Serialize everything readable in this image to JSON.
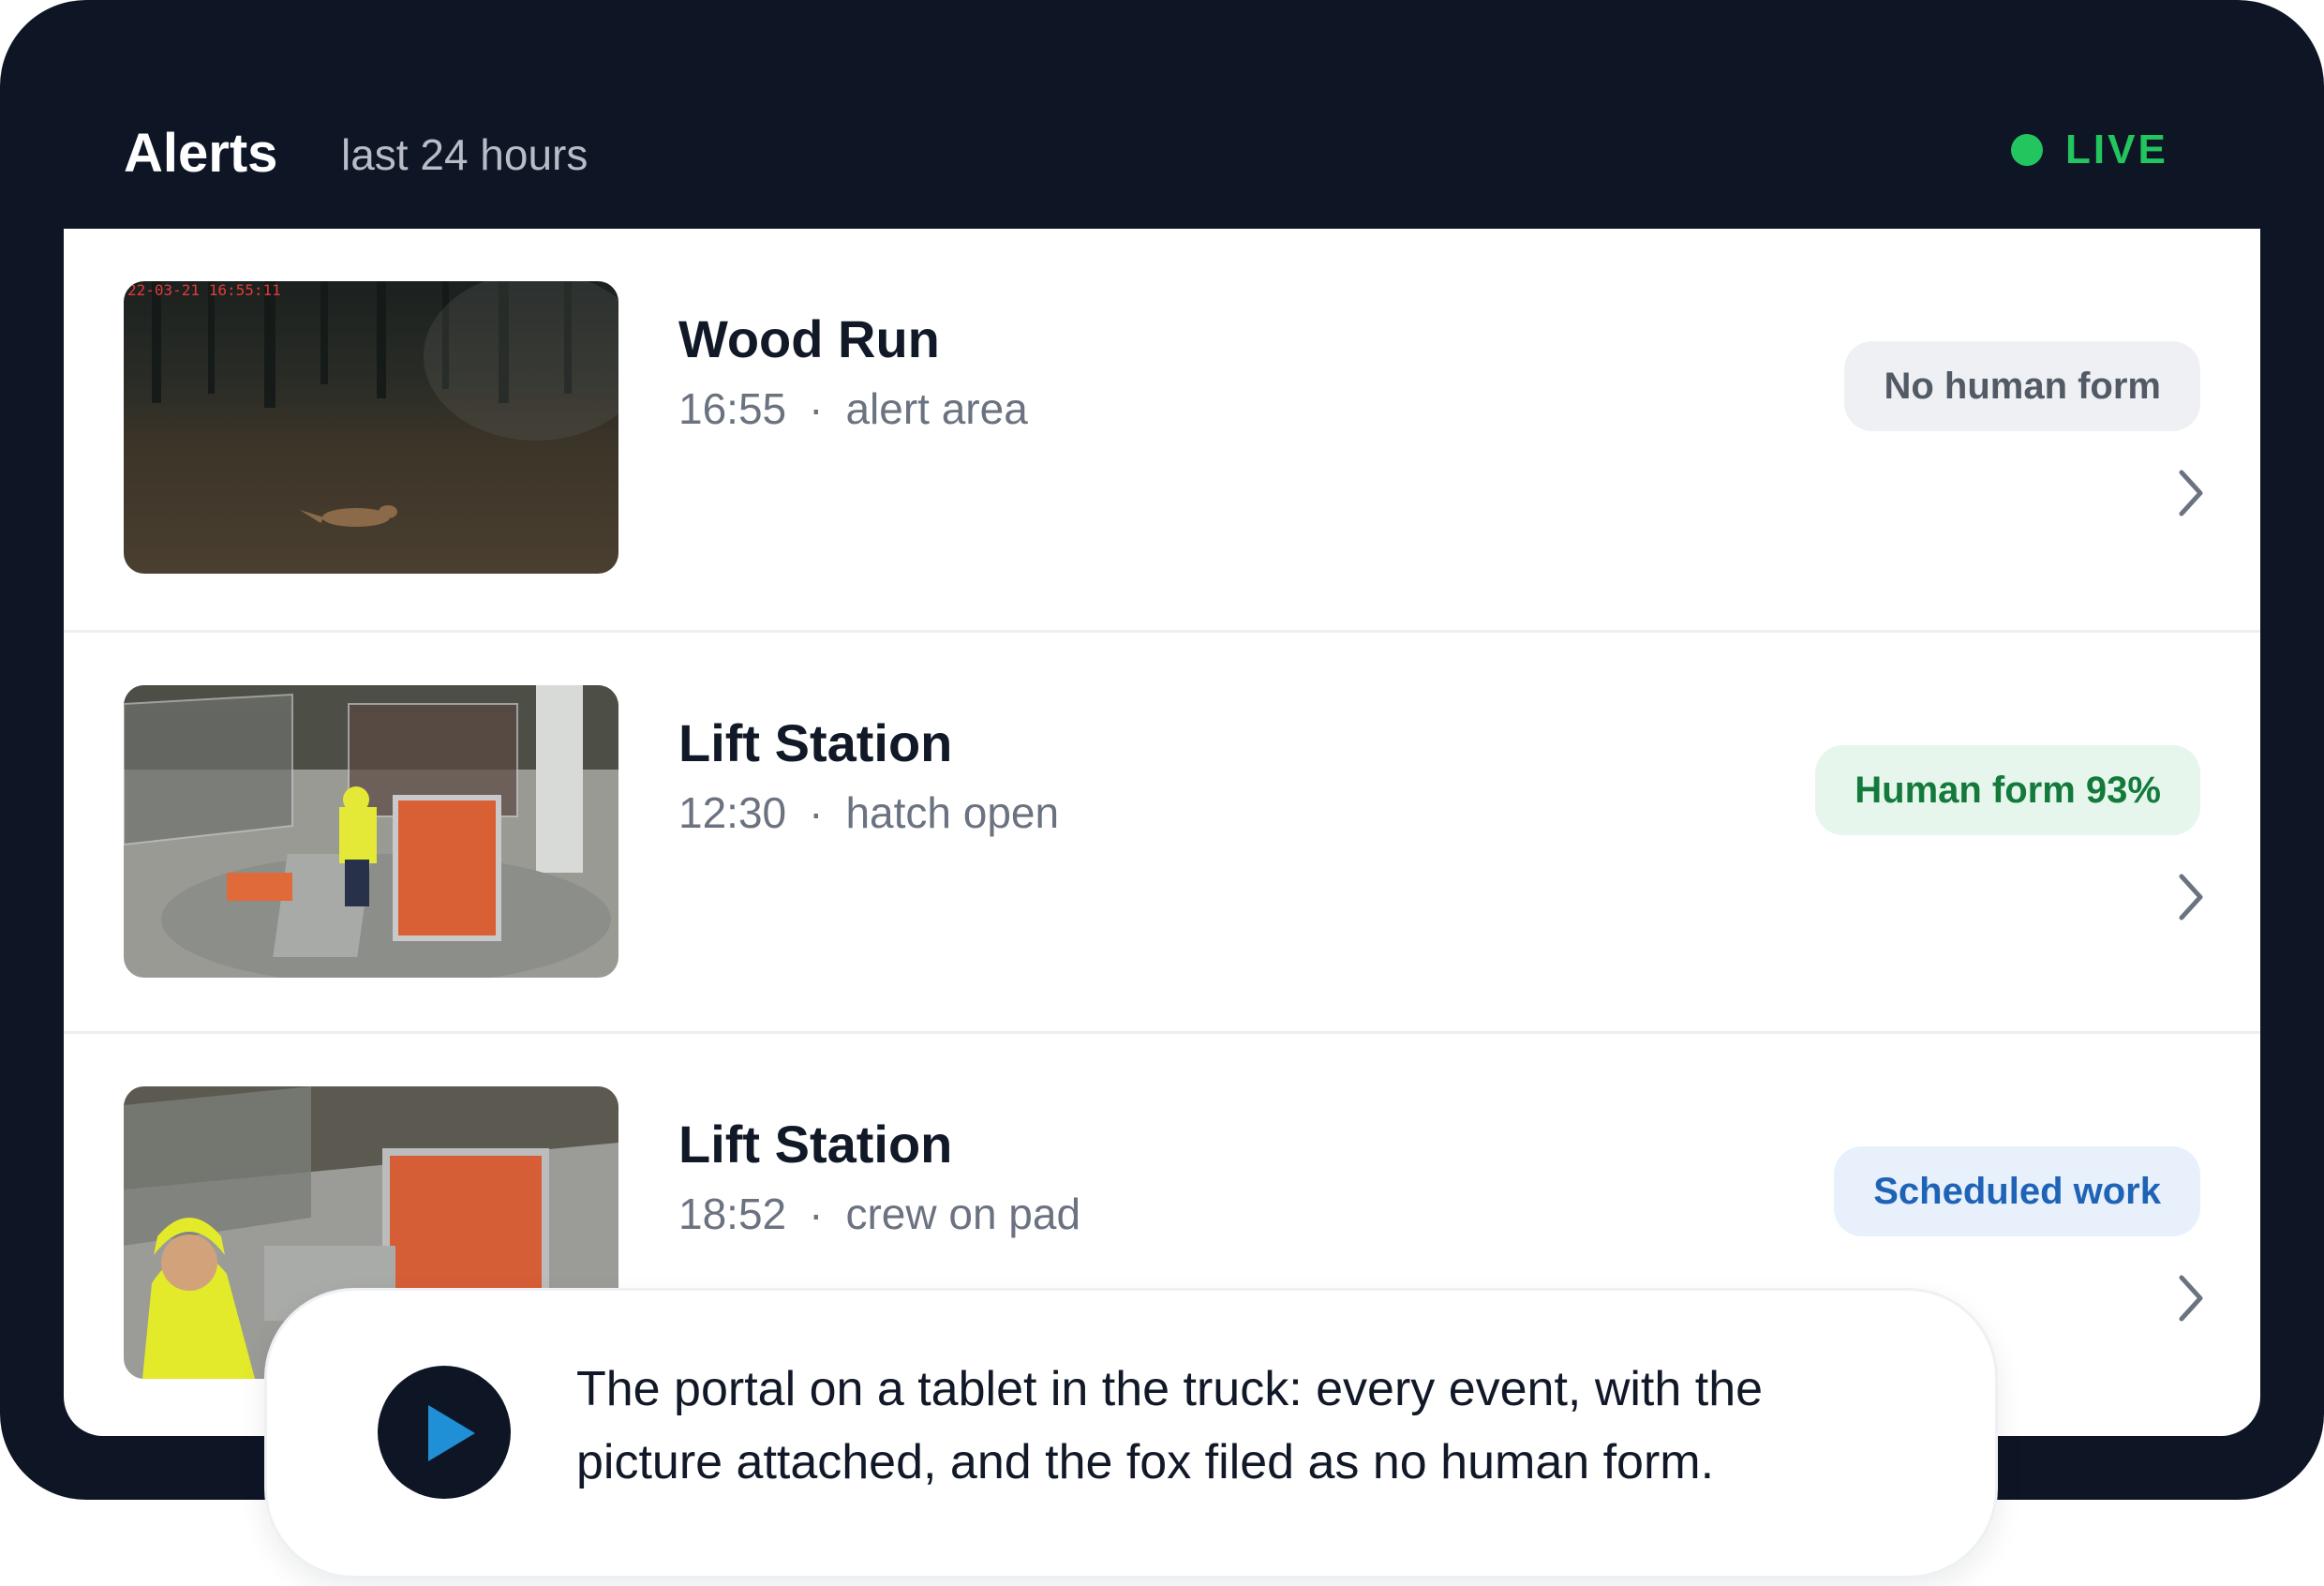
{
  "header": {
    "title": "Alerts",
    "subtitle": "last 24 hours",
    "live_label": "LIVE",
    "live_color": "#22c55e"
  },
  "alerts": [
    {
      "site": "Wood Run",
      "time": "16:55",
      "separator": "·",
      "event": "alert area",
      "badge": "No human form",
      "badge_style": "neutral",
      "thumbnail_overlay": "22-03-21 16:55:11"
    },
    {
      "site": "Lift Station",
      "time": "12:30",
      "separator": "·",
      "event": "hatch open",
      "badge": "Human form 93%",
      "badge_style": "green"
    },
    {
      "site": "Lift Station",
      "time": "18:52",
      "separator": "·",
      "event": "crew on pad",
      "badge": "Scheduled work",
      "badge_style": "blue"
    }
  ],
  "caption": {
    "text": "The portal on a tablet in the truck: every event, with the picture attached, and the fox filed as no human form."
  },
  "icons": {
    "row_action": "chevron-right-icon",
    "caption_action": "play-icon"
  },
  "colors": {
    "frame": "#0e1626",
    "play_triangle": "#1f8fd6"
  }
}
